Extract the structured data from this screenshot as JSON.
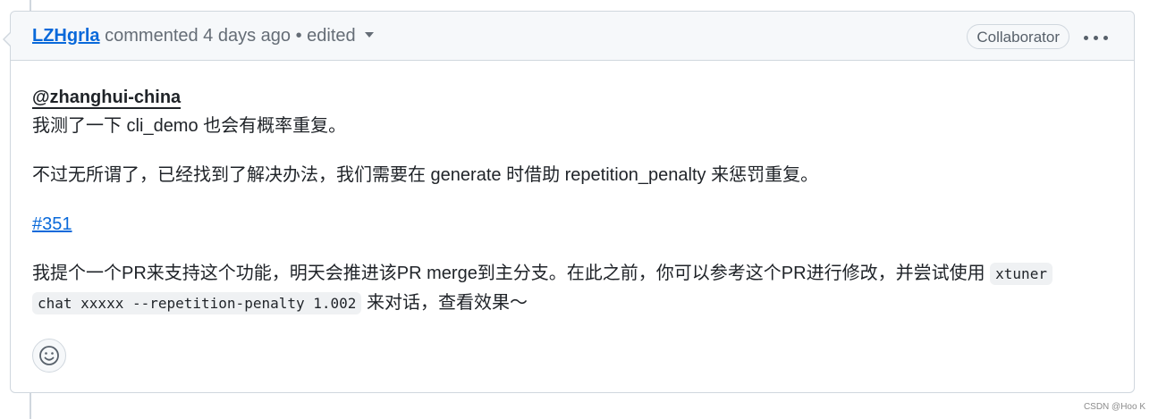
{
  "comment": {
    "author": "LZHgrla",
    "meta": "commented 4 days ago",
    "separator": "•",
    "edited": "edited",
    "badge": "Collaborator",
    "body": {
      "mention": "@zhanghui-china",
      "line1": "我测了一下 cli_demo 也会有概率重复。",
      "line2": "不过无所谓了，已经找到了解决办法，我们需要在 generate 时借助 repetition_penalty 来惩罚重复。",
      "issue_ref": "#351",
      "line4_pre": "我提个一个PR来支持这个功能，明天会推进该PR merge到主分支。在此之前，你可以参考这个PR进行修改，并尝试使用 ",
      "code1": "xtuner",
      "code2": "chat xxxxx --repetition-penalty 1.002",
      "line4_post": " 来对话，查看效果～"
    }
  },
  "icons": {
    "menu": "kebab-horizontal-icon",
    "reaction": "smiley-icon",
    "caret": "triangle-down-icon"
  },
  "colors": {
    "link": "#0969da",
    "border": "#d0d7de",
    "header_bg": "#f6f8fa"
  },
  "watermark": "CSDN @Hoo K"
}
